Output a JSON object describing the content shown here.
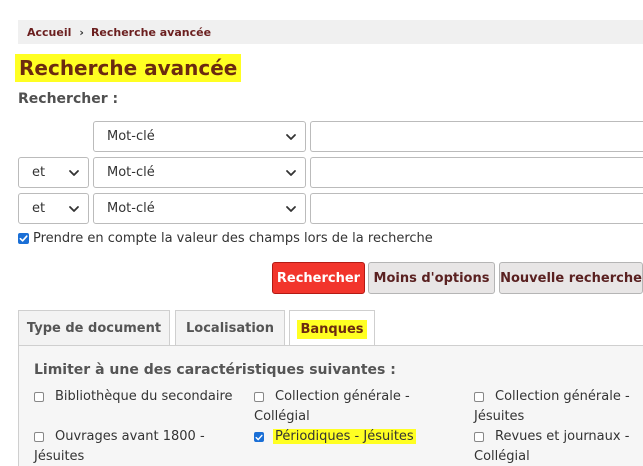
{
  "breadcrumb": {
    "home": "Accueil",
    "separator": "›",
    "current": "Recherche avancée"
  },
  "page_title": "Recherche avancée",
  "search_label": "Rechercher :",
  "search_rows": [
    {
      "operator": "",
      "field": "Mot-clé",
      "value": ""
    },
    {
      "operator": "et",
      "field": "Mot-clé",
      "value": ""
    },
    {
      "operator": "et",
      "field": "Mot-clé",
      "value": ""
    }
  ],
  "keep_values": {
    "label": "Prendre en compte la valeur des champs lors de la recherche",
    "checked": true
  },
  "buttons": {
    "search": "Rechercher",
    "fewer_options": "Moins d'options",
    "new_search": "Nouvelle recherche"
  },
  "tabs": [
    {
      "label": "Type de document",
      "active": false
    },
    {
      "label": "Localisation",
      "active": false
    },
    {
      "label": "Banques",
      "active": true
    }
  ],
  "limit_label": "Limiter à une des caractéristiques suivantes :",
  "options": [
    {
      "label": "Bibliothèque du secondaire",
      "checked": false
    },
    {
      "label": "Collection générale - Collégial",
      "checked": false
    },
    {
      "label": "Collection générale - Jésuites",
      "checked": false
    },
    {
      "label": "Ouvrages avant 1800 - Jésuites",
      "checked": false
    },
    {
      "label": "Périodiques - Jésuites",
      "checked": true
    },
    {
      "label": "Revues et journaux - Collégial",
      "checked": false
    }
  ],
  "colors": {
    "highlight": "#ffff22",
    "primary": "#f2352c",
    "brand_text": "#6b1f1f",
    "checkbox": "#1a6fd6"
  }
}
